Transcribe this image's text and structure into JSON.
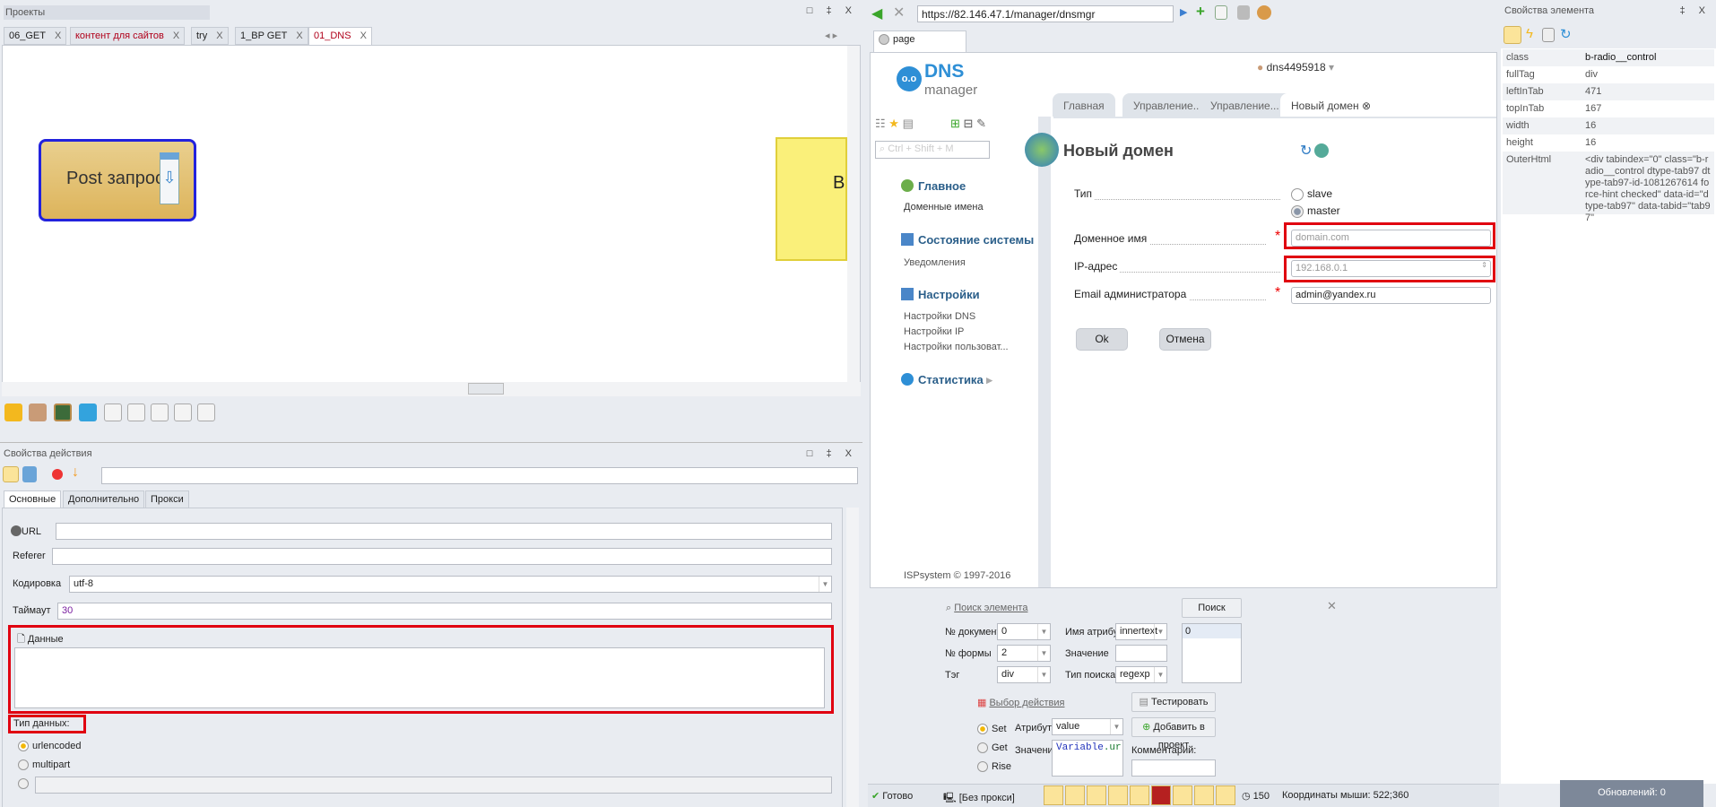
{
  "projects": {
    "title": "Проекты",
    "tabs": [
      {
        "label": "06_GET",
        "color": "#222"
      },
      {
        "label": "контент для сайтов",
        "color": "#b0001a"
      },
      {
        "label": "try",
        "color": "#222"
      },
      {
        "label": "1_BP GET",
        "color": "#222"
      },
      {
        "label": "01_DNS",
        "color": "#b0001a"
      }
    ],
    "node_label": "Post запрос",
    "yellow_node_label": "B"
  },
  "action": {
    "title": "Свойства действия",
    "tabs": [
      "Основные",
      "Дополнительно",
      "Прокси"
    ],
    "url_label": "URL",
    "url_value": "",
    "referer_label": "Referer",
    "referer_value": "",
    "encoding_label": "Кодировка",
    "encoding_value": "utf-8",
    "timeout_label": "Таймаут",
    "timeout_value": "30",
    "data_label": "Данные",
    "data_value": "",
    "datatype_label": "Тип данных:",
    "datatypes": [
      {
        "label": "urlencoded",
        "checked": true
      },
      {
        "label": "multipart",
        "checked": false
      }
    ]
  },
  "browser": {
    "url": "https://82.146.47.1/manager/dnsmgr",
    "page_tab": "page",
    "logo": {
      "top": "DNS",
      "bottom": "manager"
    },
    "user": "dns4495918",
    "search_placeholder": "Ctrl + Shift + M",
    "nav": {
      "main": "Главное",
      "domains": "Доменные имена",
      "status": "Состояние системы",
      "notifications": "Уведомления",
      "settings": "Настройки",
      "dns_settings": "Настройки DNS",
      "ip_settings": "Настройки IP",
      "user_settings": "Настройки пользоват...",
      "stats": "Статистика",
      "copyright": "ISPsystem © 1997-2016"
    },
    "tabs": [
      "Главная",
      "Управление...",
      "Управление...",
      "Новый домен"
    ],
    "form": {
      "title": "Новый домен",
      "type_label": "Тип",
      "type_options": [
        "slave",
        "master"
      ],
      "domain_label": "Доменное имя",
      "domain_placeholder": "domain.com",
      "ip_label": "IP-адрес",
      "ip_placeholder": "192.168.0.1",
      "email_label": "Email администратора",
      "email_value": "admin@yandex.ru",
      "ok": "Ok",
      "cancel": "Отмена"
    }
  },
  "search": {
    "title": "Поиск элемента",
    "search_btn": "Поиск",
    "doc_label": "№ документа",
    "doc_value": "0",
    "form_label": "№ формы",
    "form_value": "2",
    "tag_label": "Тэг",
    "tag_value": "div",
    "attr_name_label": "Имя атрибута",
    "attr_name_value": "innertext",
    "value_label": "Значение",
    "value_value": "",
    "search_type_label": "Тип поиска",
    "search_type_value": "regexp",
    "results": [
      "0"
    ],
    "action_title": "Выбор действия",
    "test_btn": "Тестировать",
    "actions": [
      "Set",
      "Get",
      "Rise"
    ],
    "attr_label": "Атрибут",
    "attr_value": "value",
    "val_label": "Значение",
    "val_value_var": "Variable",
    "val_value_rest": ".url_dn",
    "add_btn": "Добавить в проект",
    "comment_label": "Комментарий:",
    "comment_value": ""
  },
  "status": {
    "ready": "Готово",
    "proxy": "[Без прокси]",
    "timer": "150",
    "mouse": "Координаты мыши: 522;360"
  },
  "props": {
    "title": "Свойства элемента",
    "rows": [
      [
        "class",
        "b-radio__control"
      ],
      [
        "fullTag",
        "div"
      ],
      [
        "leftInTab",
        "471"
      ],
      [
        "topInTab",
        "167"
      ],
      [
        "width",
        "16"
      ],
      [
        "height",
        "16"
      ]
    ],
    "outer_label": "OuterHtml",
    "outer_value": "<div tabindex=\"0\" class=\"b-radio__control dtype-tab97 dtype-tab97-id-1081267614 force-hint checked\" data-id=\"dtype-tab97\" data-tabid=\"tab97\"",
    "updates": "Обновлений: 0"
  }
}
